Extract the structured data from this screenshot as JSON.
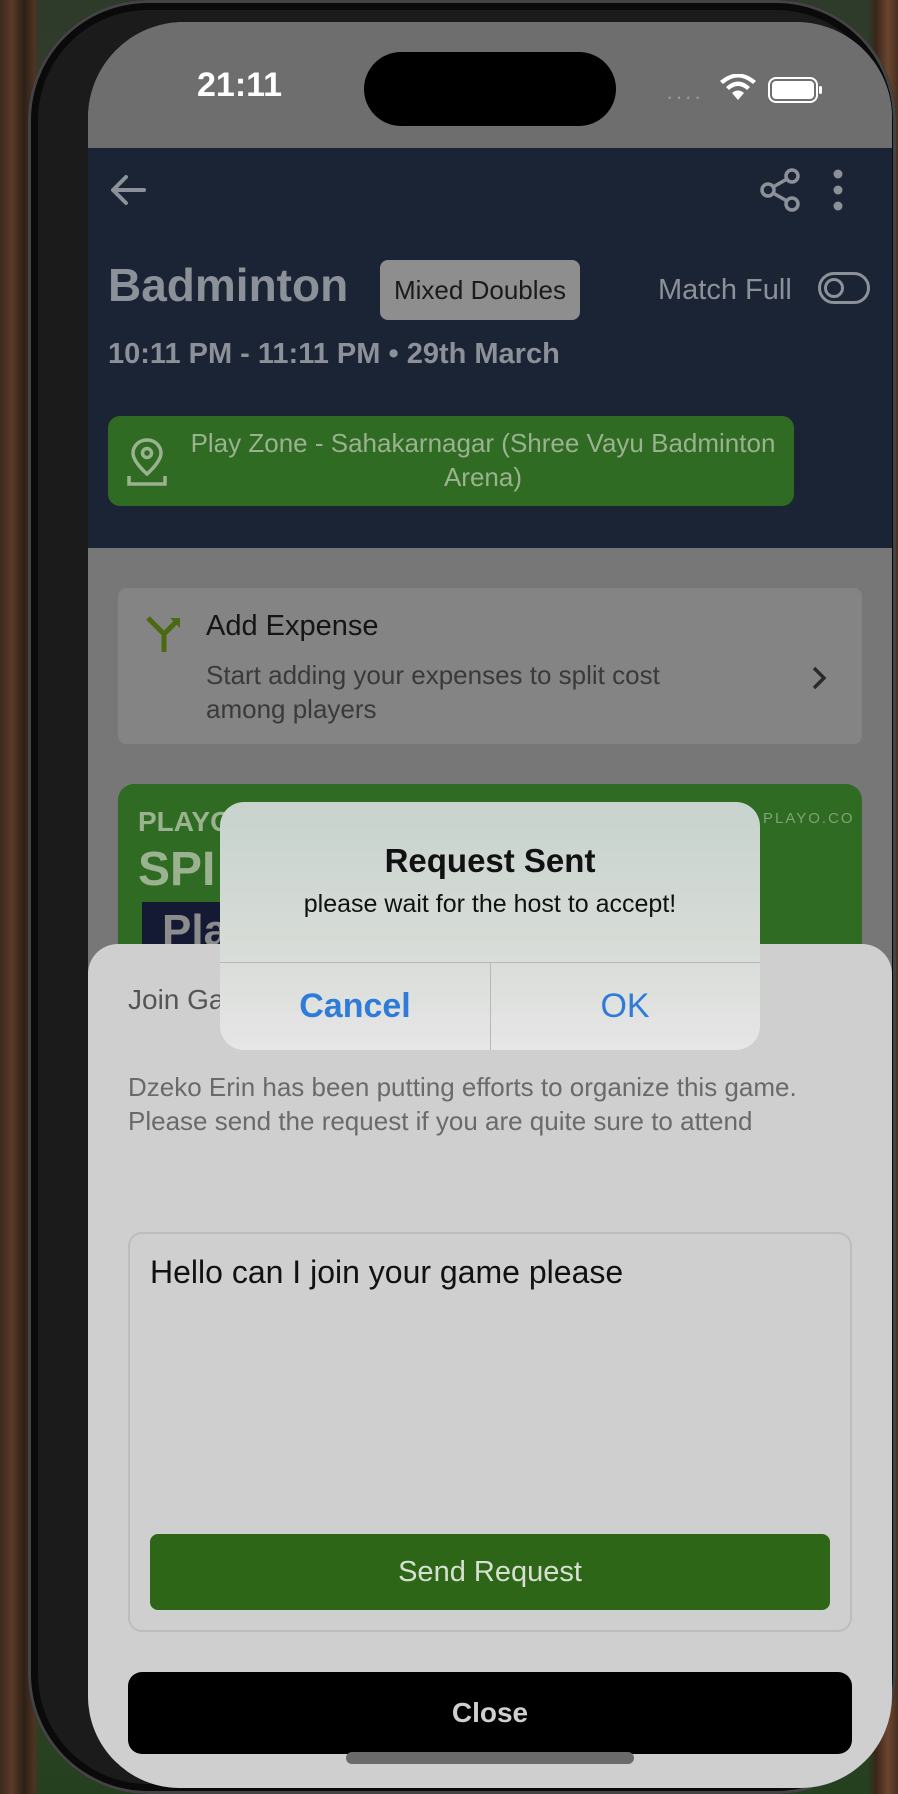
{
  "status_bar": {
    "time": "21:11"
  },
  "header": {
    "title": "Badminton",
    "badge": "Mixed Doubles",
    "match_full_label": "Match Full",
    "datetime": "10:11 PM - 11:11 PM • 29th March",
    "venue": "Play Zone - Sahakarnagar (Shree Vayu Badminton Arena)"
  },
  "expense": {
    "title": "Add Expense",
    "subtitle": "Start adding your expenses to split cost among players"
  },
  "banner": {
    "brand": "PLAYO",
    "site": "PLAYO.CO",
    "headline_partial": "SPI",
    "subhead_partial": "Pla"
  },
  "sheet": {
    "title_partial": "Join Ga",
    "description": "Dzeko Erin has been putting efforts to organize this game. Please send the request if you are quite sure to attend",
    "message_value": "Hello can I join your game please",
    "send_label": "Send Request",
    "close_label": "Close"
  },
  "alert": {
    "title": "Request Sent",
    "message": "please wait for the host to accept!",
    "cancel_label": "Cancel",
    "ok_label": "OK"
  },
  "colors": {
    "header_bg": "#1b2434",
    "venue_green": "#2f6b22",
    "send_green": "#2e6618",
    "alert_button_blue": "#2f7bd8"
  }
}
